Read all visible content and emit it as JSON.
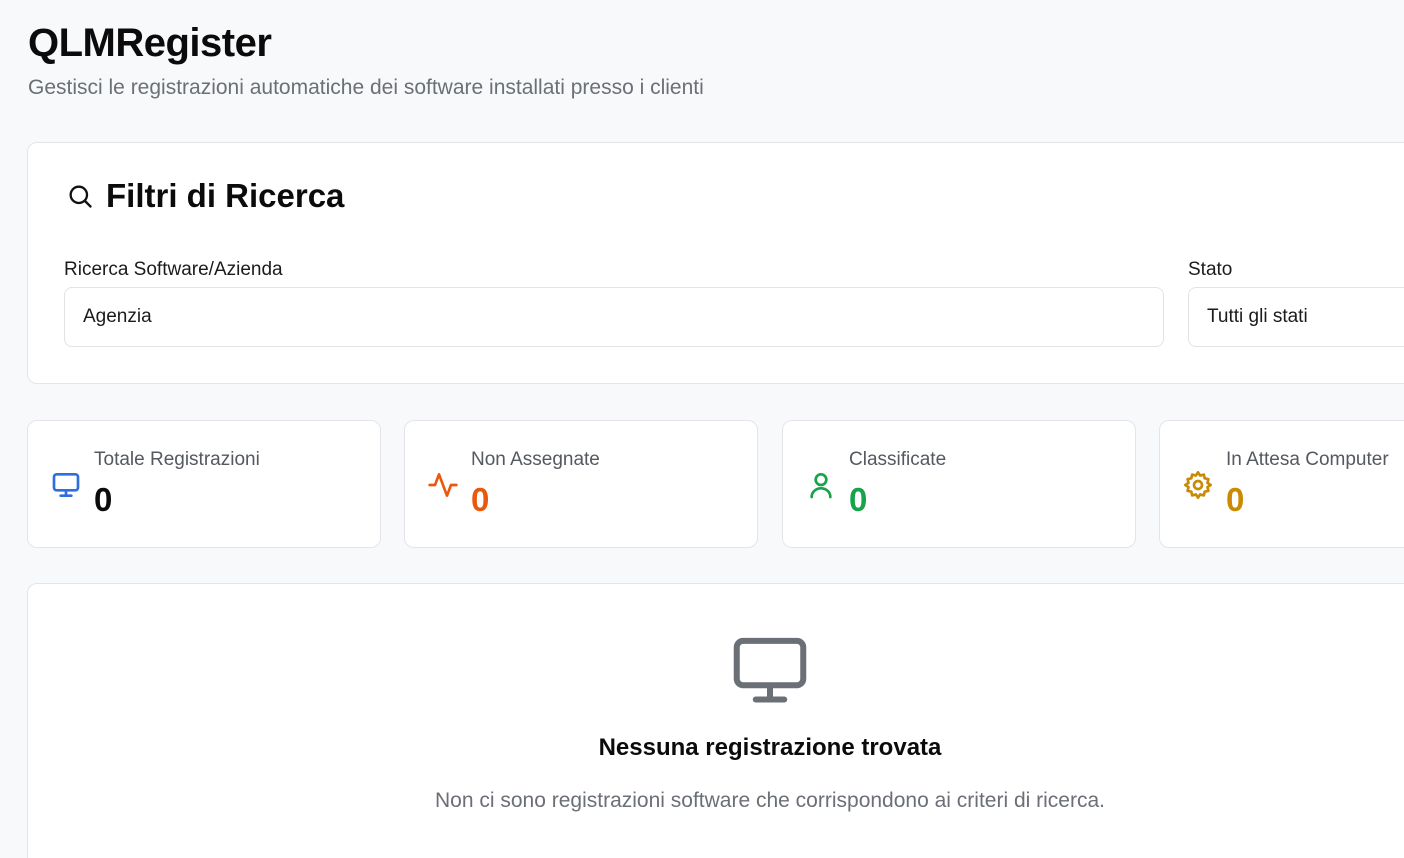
{
  "header": {
    "title": "QLMRegister",
    "subtitle": "Gestisci le registrazioni automatiche dei software installati presso i clienti"
  },
  "filters": {
    "title": "Filtri di Ricerca",
    "title_icon": "search-icon",
    "search_label": "Ricerca Software/Azienda",
    "search_value": "Agenzia",
    "status_label": "Stato",
    "status_selected": "Tutti gli stati"
  },
  "stats": [
    {
      "label": "Totale Registrazioni",
      "value": "0",
      "icon": "monitor-icon",
      "color": "#2f6fdc",
      "value_color": "#0b0b0b"
    },
    {
      "label": "Non Assegnate",
      "value": "0",
      "icon": "activity-icon",
      "color": "#ea580c",
      "value_color": "#ea580c"
    },
    {
      "label": "Classificate",
      "value": "0",
      "icon": "user-icon",
      "color": "#16a34a",
      "value_color": "#16a34a"
    },
    {
      "label": "In Attesa Computer",
      "value": "0",
      "icon": "gear-icon",
      "color": "#ca8a04",
      "value_color": "#ca8a04"
    }
  ],
  "empty_state": {
    "icon": "monitor-icon",
    "title": "Nessuna registrazione trovata",
    "description": "Non ci sono registrazioni software che corrispondono ai criteri di ricerca."
  }
}
